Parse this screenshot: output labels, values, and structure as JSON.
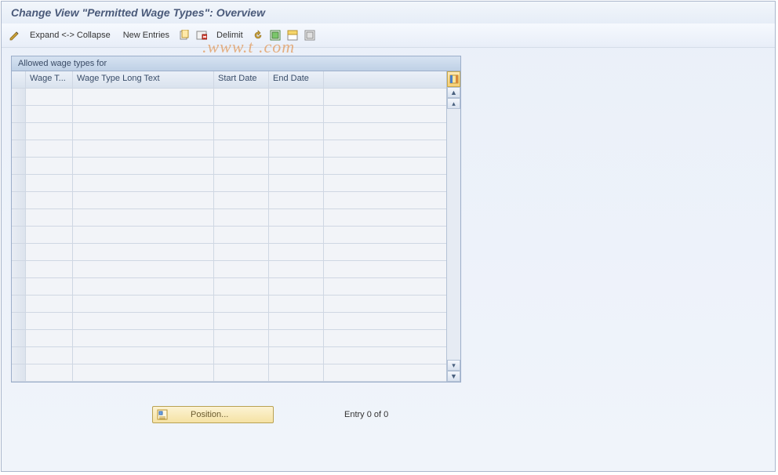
{
  "header": {
    "title": "Change View \"Permitted Wage Types\": Overview"
  },
  "toolbar": {
    "expand_collapse": "Expand <-> Collapse",
    "new_entries": "New Entries",
    "delimit": "Delimit",
    "icons": {
      "pencil": "toggle-change",
      "copy": "copy",
      "delete_row": "delete",
      "undo": "undo",
      "select_all": "select-all",
      "select_block": "select-block",
      "deselect": "deselect-all"
    }
  },
  "table": {
    "frame_title": "Allowed wage types for",
    "columns": {
      "wage_type": "Wage T...",
      "long_text": "Wage Type Long Text",
      "start_date": "Start Date",
      "end_date": "End Date"
    },
    "rows": [
      {
        "wage_type": "",
        "long_text": "",
        "start_date": "",
        "end_date": ""
      },
      {
        "wage_type": "",
        "long_text": "",
        "start_date": "",
        "end_date": ""
      },
      {
        "wage_type": "",
        "long_text": "",
        "start_date": "",
        "end_date": ""
      },
      {
        "wage_type": "",
        "long_text": "",
        "start_date": "",
        "end_date": ""
      },
      {
        "wage_type": "",
        "long_text": "",
        "start_date": "",
        "end_date": ""
      },
      {
        "wage_type": "",
        "long_text": "",
        "start_date": "",
        "end_date": ""
      },
      {
        "wage_type": "",
        "long_text": "",
        "start_date": "",
        "end_date": ""
      },
      {
        "wage_type": "",
        "long_text": "",
        "start_date": "",
        "end_date": ""
      },
      {
        "wage_type": "",
        "long_text": "",
        "start_date": "",
        "end_date": ""
      },
      {
        "wage_type": "",
        "long_text": "",
        "start_date": "",
        "end_date": ""
      },
      {
        "wage_type": "",
        "long_text": "",
        "start_date": "",
        "end_date": ""
      },
      {
        "wage_type": "",
        "long_text": "",
        "start_date": "",
        "end_date": ""
      },
      {
        "wage_type": "",
        "long_text": "",
        "start_date": "",
        "end_date": ""
      },
      {
        "wage_type": "",
        "long_text": "",
        "start_date": "",
        "end_date": ""
      },
      {
        "wage_type": "",
        "long_text": "",
        "start_date": "",
        "end_date": ""
      },
      {
        "wage_type": "",
        "long_text": "",
        "start_date": "",
        "end_date": ""
      },
      {
        "wage_type": "",
        "long_text": "",
        "start_date": "",
        "end_date": ""
      }
    ]
  },
  "footer": {
    "position_label": "Position...",
    "entry_text": "Entry 0 of 0"
  },
  "watermark": ".www.t        .com"
}
